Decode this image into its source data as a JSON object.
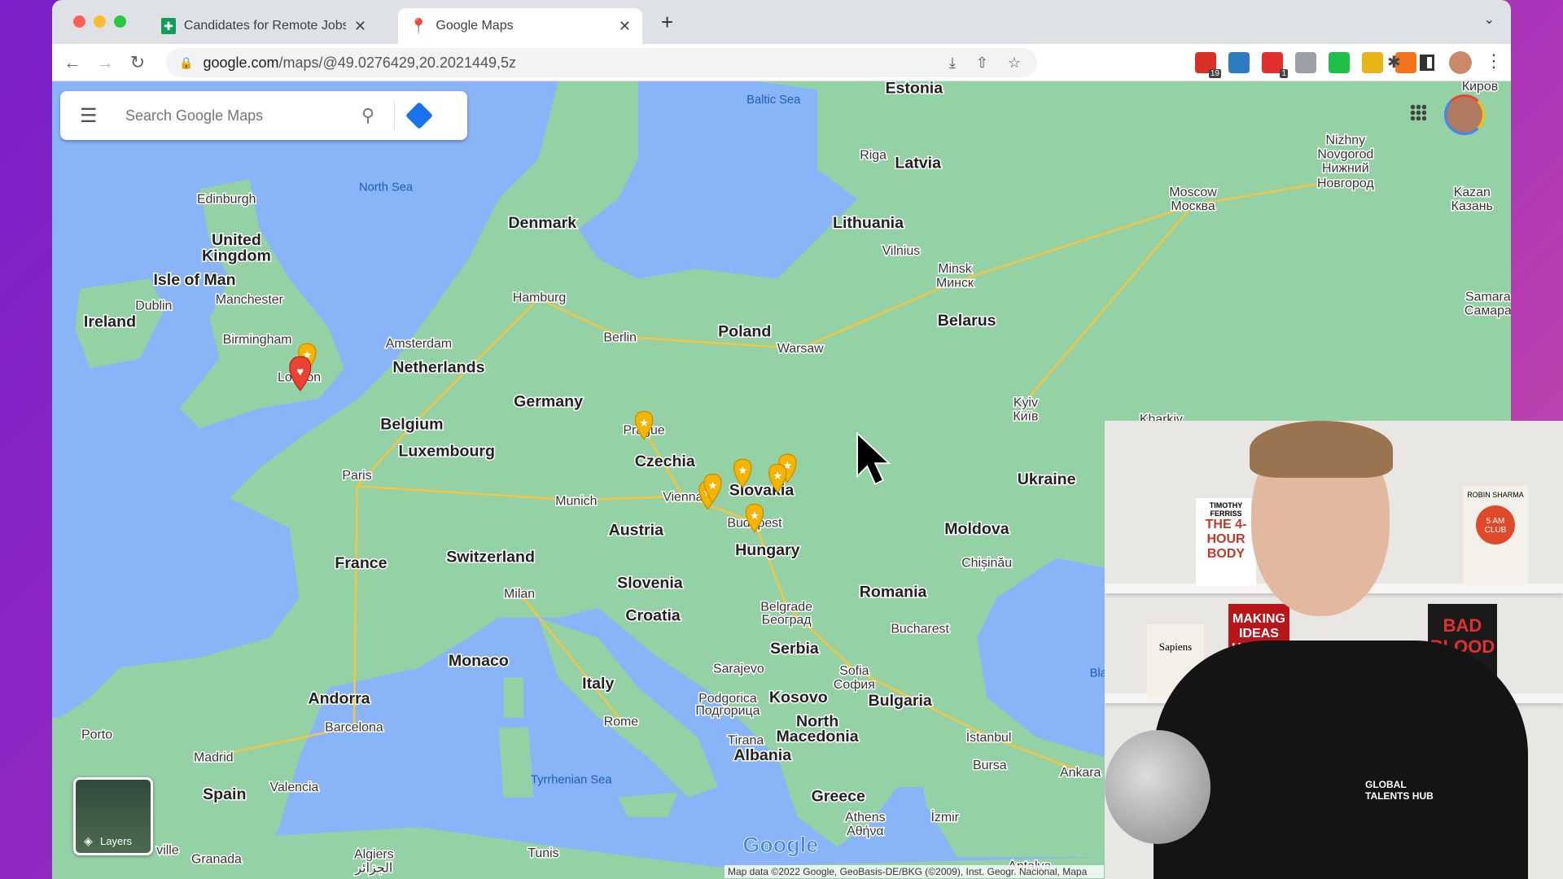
{
  "browser": {
    "tabs": [
      {
        "label": "Candidates for Remote Jobs - (",
        "icon": "google-sheets-icon"
      },
      {
        "label": "Google Maps",
        "icon": "google-maps-icon",
        "active": true
      }
    ],
    "new_tab": "+",
    "url_host": "google.com",
    "url_path": "/maps/@49.0276429,20.2021449,5z",
    "extensions": [
      {
        "name": "todo-extension",
        "badge": "19",
        "color": "#d93025"
      },
      {
        "name": "s-extension",
        "color": "#2f7bbf"
      },
      {
        "name": "adblock-extension",
        "badge": "1",
        "color": "#e02f2f"
      },
      {
        "name": "code-extension",
        "color": "#9aa0a6"
      },
      {
        "name": "chat-extension",
        "color": "#1fbf4b"
      },
      {
        "name": "broom-extension",
        "color": "#e8b41a"
      },
      {
        "name": "analytics-extension",
        "color": "#f4741e"
      }
    ]
  },
  "maps": {
    "search_placeholder": "Search Google Maps",
    "layers_label": "Layers",
    "logo": "Google",
    "attribution": "Map data ©2022 Google, GeoBasis-DE/BKG (©2009), Inst. Geogr. Nacional, Mapa",
    "colors": {
      "water": "#8ab4f8",
      "land": "#94d2a5",
      "road": "#f4c542",
      "pin": "#f5b400",
      "pin_red": "#ea4335"
    },
    "labels": [
      "Estonia",
      "Latvia",
      "Lithuania",
      "Denmark",
      "United",
      "Kingdom",
      "Ireland",
      "Poland",
      "Belarus",
      "Netherlands",
      "Germany",
      "Belgium",
      "Luxembourg",
      "Czechia",
      "Slovakia",
      "Ukraine",
      "Austria",
      "Hungary",
      "Moldova",
      "France",
      "Switzerland",
      "Slovenia",
      "Croatia",
      "Romania",
      "Serbia",
      "Monaco",
      "Italy",
      "Bulgaria",
      "Andorra",
      "Kosovo",
      "North",
      "Macedonia",
      "Albania",
      "Spain",
      "Greece",
      "Isle of Man",
      "Edinburgh",
      "Manchester",
      "Dublin",
      "Birmingham",
      "London",
      "Amsterdam",
      "Hamburg",
      "Berlin",
      "Warsaw",
      "Riga",
      "Vilnius",
      "Minsk",
      "Минск",
      "Moscow",
      "Москва",
      "Nizhny",
      "Novgorod",
      "Нижний",
      "Новгород",
      "Kazan",
      "Казань",
      "Samara",
      "Самара",
      "Kyiv",
      "Київ",
      "Kharkiv",
      "Prague",
      "Paris",
      "Munich",
      "Vienna",
      "Budapest",
      "Milan",
      "Chișinău",
      "Belgrade",
      "Београд",
      "Bucharest",
      "Sarajevo",
      "Sofia",
      "София",
      "Podgorica",
      "Подгорица",
      "Tirana",
      "Rome",
      "Barcelona",
      "Porto",
      "Madrid",
      "Valencia",
      "İstanbul",
      "Bursa",
      "Ankara",
      "İzmir",
      "Athens",
      "Αθήνα",
      "Algiers",
      "الجزائر",
      "Tunis",
      "Granada",
      "Antalya",
      "Киров",
      "ville",
      "Bla",
      "Baltic Sea",
      "North Sea",
      "Tyrrhenian Sea"
    ]
  },
  "webcam": {
    "shirt_text": "GLOBAL TALENTS HUB",
    "books": [
      "TIMOTHY FERRISS",
      "THE 4-HOUR BODY",
      "ROBIN SHARMA",
      "5 AM CLUB",
      "Sapiens",
      "MAKING IDEAS HAPPEN",
      "BAD BLOOD"
    ]
  }
}
